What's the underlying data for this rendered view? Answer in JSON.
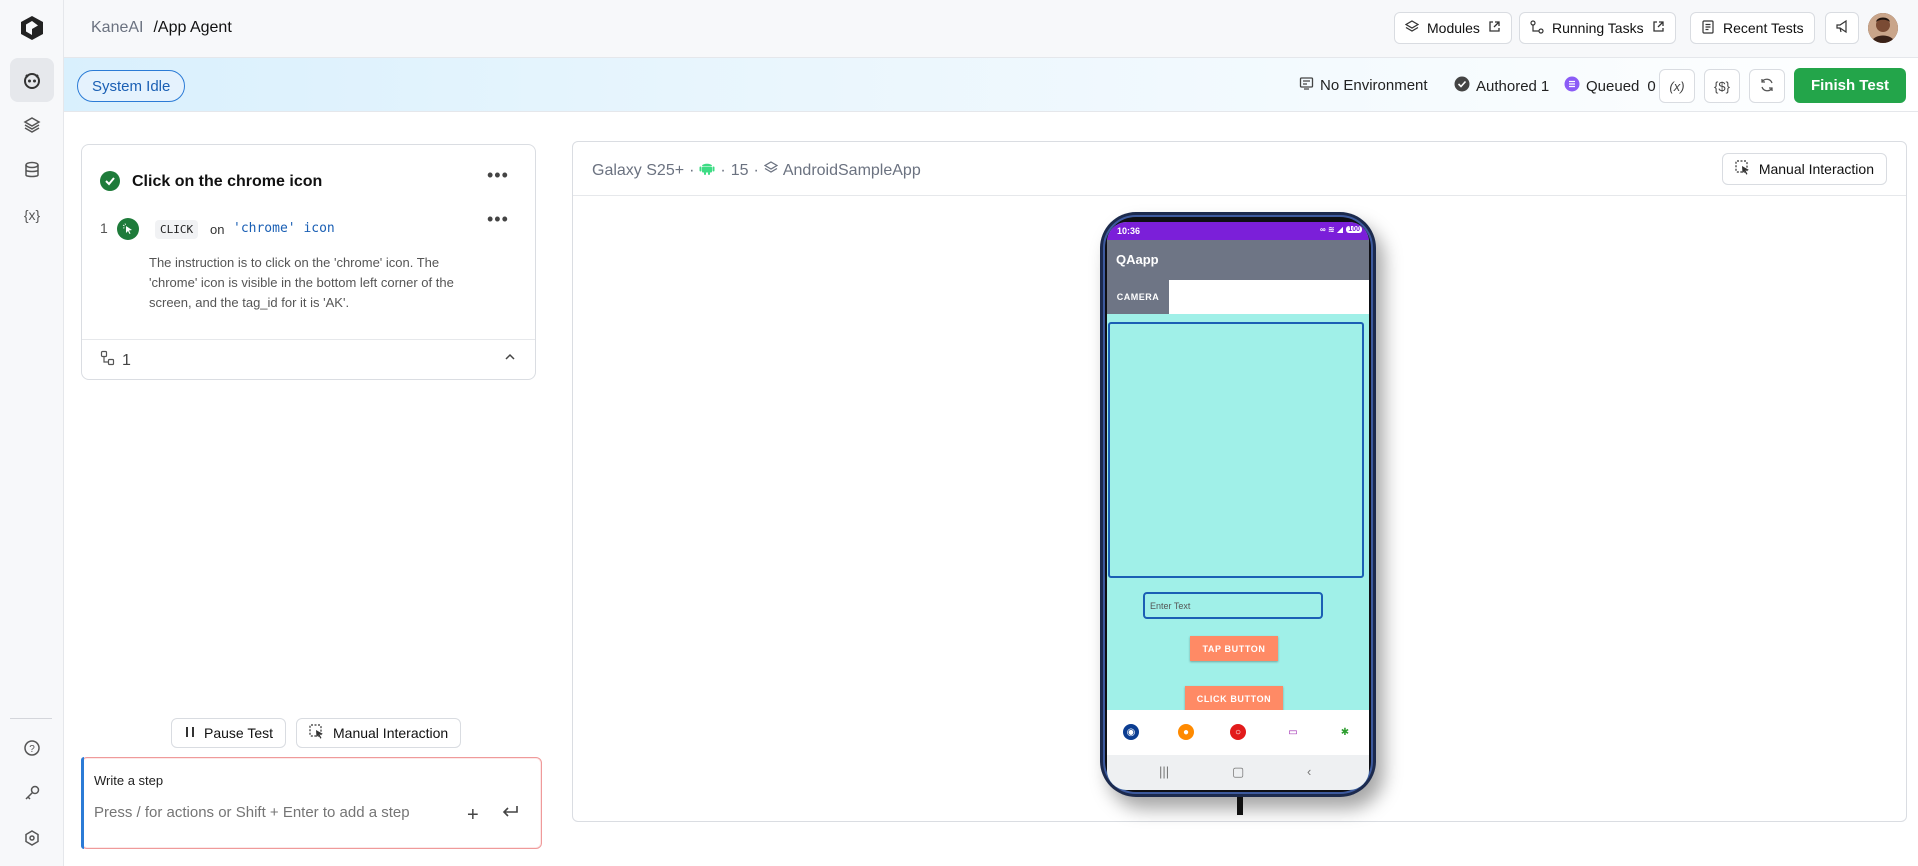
{
  "header": {
    "breadcrumb_root": "KaneAI",
    "breadcrumb_current": "/App Agent",
    "modules_label": "Modules",
    "running_tasks_label": "Running Tasks",
    "recent_tests_label": "Recent Tests"
  },
  "status": {
    "system_state": "System Idle",
    "environment": "No Environment",
    "authored_label": "Authored",
    "authored_count": "1",
    "queued_label": "Queued",
    "queued_count": "0",
    "variables_btn": "(x)",
    "secrets_btn": "{$}",
    "finish_label": "Finish Test"
  },
  "step_card": {
    "title": "Click on the chrome icon",
    "step_number": "1",
    "action_keyword": "CLICK",
    "on_text": "on",
    "target": "'chrome' icon",
    "reasoning": "The instruction is to click on the 'chrome' icon. The 'chrome' icon is visible in the bottom left corner of the screen, and the tag_id for it is 'AK'.",
    "footer_count": "1"
  },
  "controls": {
    "pause_label": "Pause Test",
    "manual_label": "Manual Interaction"
  },
  "composer": {
    "label": "Write a step",
    "placeholder": "Press / for actions or Shift + Enter to add a step"
  },
  "device": {
    "name": "Galaxy S25+",
    "os_version": "15",
    "app_name": "AndroidSampleApp",
    "manual_label": "Manual Interaction",
    "screen": {
      "time": "10:36",
      "battery": "100",
      "app_title": "QAapp",
      "tab_label": "CAMERA",
      "text_input_placeholder": "Enter Text",
      "tap_button": "TAP BUTTON",
      "click_button": "CLICK BUTTON"
    }
  },
  "colors": {
    "accent_green": "#23a54a",
    "accent_blue": "#2b7bd6",
    "app_background": "#a0f0e8",
    "status_bar_purple": "#7b1fd9",
    "button_orange": "#ff8a65"
  }
}
